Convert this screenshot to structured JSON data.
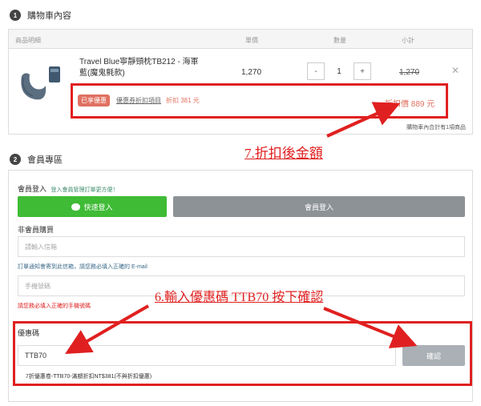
{
  "cart": {
    "section_num": "1",
    "section_title": "購物車內容",
    "headers": {
      "product": "商品明細",
      "unit_price": "單價",
      "qty": "數量",
      "subtotal": "小計"
    },
    "item": {
      "name": "Travel Blue寧靜頸枕TB212 - 海軍藍(魔鬼氈款)",
      "price": "1,270",
      "qty": "1",
      "qty_minus": "-",
      "qty_plus": "+",
      "subtotal": "1,270",
      "remove": "✕"
    },
    "coupon": {
      "badge": "已享優惠",
      "link": "優惠券折扣項目",
      "discount": "折扣 381 元",
      "discounted_price": "折扣價 889 元"
    },
    "footer": "購物車內合計有1項商品"
  },
  "annotations": {
    "a7": "7.折扣後金額",
    "a6": "6.輸入優惠碼 TTB70 按下確認"
  },
  "member": {
    "section_num": "2",
    "section_title": "會員專區",
    "login_label": "會員登入",
    "login_note": "登入會員管理訂單更方便！",
    "line_button": "快速登入",
    "member_button": "會員登入",
    "guest_label": "非會員購買",
    "email_placeholder": "請輸入信箱",
    "email_note": "訂單通知會寄到此信箱，請您務必填入正確的 E-mail",
    "phone_placeholder": "手機號碼",
    "phone_note": "請您務必填入正確的手機號碼",
    "coupon_label": "優惠碼",
    "coupon_value": "TTB70",
    "confirm_button": "確認",
    "coupon_note": "7折優惠卷-TTB70-滿額折扣NT$381(不與折扣優惠)"
  },
  "colors": {
    "accent_red": "#e02020",
    "line_green": "#3fbb35",
    "discount": "#e07060"
  }
}
